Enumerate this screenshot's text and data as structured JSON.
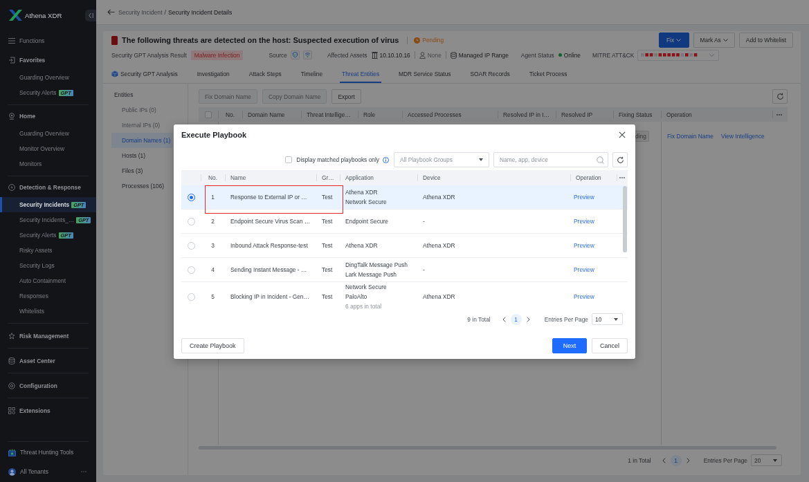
{
  "sidebar": {
    "brand": "Athena XDR",
    "functions_label": "Functions",
    "sections": [
      {
        "title": "Favorites",
        "items": [
          {
            "label": "Guarding Overview",
            "selected": false
          },
          {
            "label": "Security Alerts",
            "badge": "GPT",
            "selected": false
          }
        ]
      },
      {
        "title": "Home",
        "items": [
          {
            "label": "Guarding Overview",
            "selected": false
          },
          {
            "label": "Monitor Overview",
            "selected": false
          },
          {
            "label": "Monitors",
            "selected": false
          }
        ]
      },
      {
        "title": "Detection & Response",
        "items": [
          {
            "label": "Security Incidents",
            "badge": "GPT",
            "selected": true
          },
          {
            "label": "Security Incidents_…",
            "badge": "GPT",
            "selected": false
          },
          {
            "label": "Security Alerts",
            "badge": "GPT",
            "selected": false
          },
          {
            "label": "Risky Assets",
            "selected": false
          },
          {
            "label": "Security Logs",
            "selected": false
          },
          {
            "label": "Auto Containment",
            "selected": false
          },
          {
            "label": "Responses",
            "selected": false
          },
          {
            "label": "Whitelists",
            "selected": false
          }
        ]
      },
      {
        "title": "Risk Management"
      },
      {
        "title": "Asset Center"
      },
      {
        "title": "Configuration"
      },
      {
        "title": "Extensions"
      }
    ],
    "tools_link": "Threat Hunting Tools",
    "tenant": "All Tenants"
  },
  "breadcrumb": {
    "items": [
      "Security Incident",
      "Security Incident Details"
    ],
    "separator": "/"
  },
  "incident": {
    "title": "The following threats are detected on the host: Suspected execution of virus",
    "status": "Pending",
    "actions": [
      {
        "label": "Fix",
        "kind": "primary",
        "dropdown": true
      },
      {
        "label": "Mark As",
        "kind": "default",
        "dropdown": true
      },
      {
        "label": "Add to Whitelist",
        "kind": "default",
        "dropdown": false
      }
    ],
    "analysis_label": "Security GPT Analysis Result",
    "analysis_result": "Malware Infection",
    "source_label": "Source",
    "assets_label": "Affected Assets",
    "asset_ip": "10.10.10.16",
    "asset_user": "None",
    "asset_scope": "Managed IP Range",
    "agent_status_label": "Agent Status",
    "agent_status": "Online",
    "mitre_label": "MITRE ATT&CK"
  },
  "tabs": [
    {
      "label": "Security GPT Analysis",
      "selected": false
    },
    {
      "label": "Investigation",
      "selected": false
    },
    {
      "label": "Attack Steps",
      "selected": false
    },
    {
      "label": "Timeline",
      "selected": false
    },
    {
      "label": "Threat Entities",
      "selected": true
    },
    {
      "label": "MDR Service Status",
      "selected": false
    },
    {
      "label": "SOAR Records",
      "selected": false
    },
    {
      "label": "Ticket Process",
      "selected": false
    }
  ],
  "entities": {
    "title": "Entities",
    "items": [
      {
        "label": "Public IPs (0)",
        "disabled": true,
        "selected": false
      },
      {
        "label": "Internal IPs (0)",
        "disabled": true,
        "selected": false
      },
      {
        "label": "Domain Names (1)",
        "disabled": false,
        "selected": true
      },
      {
        "label": "Hosts (1)",
        "disabled": false,
        "selected": false
      },
      {
        "label": "Files (3)",
        "disabled": false,
        "selected": false
      },
      {
        "label": "Processes (106)",
        "disabled": false,
        "selected": false
      }
    ]
  },
  "entity_table": {
    "actions": [
      {
        "label": "Fix Domain Name",
        "disabled": true
      },
      {
        "label": "Copy Domain Name",
        "disabled": true
      },
      {
        "label": "Export",
        "disabled": false
      }
    ],
    "select_all": {
      "checked": false
    },
    "columns": [
      "No.",
      "Domain Name",
      "Threat Intellige…",
      "Role",
      "Accessed Processes",
      "Resolved IP in I…",
      "Resolved IP",
      "Fixing Status",
      "Operation"
    ],
    "rows": [
      {
        "fixing_status": "ding",
        "operations": [
          "Fix Domain Name",
          "View Intelligence"
        ]
      }
    ],
    "pagination": {
      "total": "1 in Total",
      "pages": [
        {
          "label": "1",
          "selected": true
        }
      ],
      "page_size_label": "Entries Per Page",
      "page_size": "20"
    }
  },
  "dialog": {
    "title": "Execute Playbook",
    "filter": {
      "matched_only": {
        "label": "Display matched playbooks only",
        "checked": false
      },
      "group_select": {
        "placeholder": "All Playbook Groups"
      },
      "search": {
        "placeholder": "Name, app, device"
      }
    },
    "columns": [
      "No.",
      "Name",
      "Gr…",
      "Application",
      "Device",
      "Operation"
    ],
    "rows": [
      {
        "no": "1",
        "name": "Response to External IP or …",
        "group": "Test",
        "applications": [
          "Athena XDR",
          "Network Secure"
        ],
        "device": "Athena XDR",
        "operation": "Preview",
        "selected": true,
        "highlighted": true
      },
      {
        "no": "2",
        "name": "Endpoint Secure Virus Scan …",
        "group": "Test",
        "applications": [
          "Endpoint Secure"
        ],
        "device": "-",
        "operation": "Preview",
        "selected": false,
        "highlighted": false
      },
      {
        "no": "3",
        "name": "Inbound Attack Response-test",
        "group": "Test",
        "applications": [
          "Athena XDR"
        ],
        "device": "Athena XDR",
        "operation": "Preview",
        "selected": false,
        "highlighted": false
      },
      {
        "no": "4",
        "name": "Sending Instant Message - …",
        "group": "Test",
        "applications": [
          "DingTalk Message Push",
          "Lark Message Push"
        ],
        "device": "-",
        "operation": "Preview",
        "selected": false,
        "highlighted": false
      },
      {
        "no": "5",
        "name": "Blocking IP in Incident - Gen…",
        "group": "Test",
        "applications": [
          "Network Secure",
          "PaloAlto"
        ],
        "apps_total": "6 apps in total",
        "device": "Athena XDR",
        "operation": "Preview",
        "selected": false,
        "highlighted": false
      }
    ],
    "pagination": {
      "total": "9 in Total",
      "pages": [
        {
          "label": "1",
          "selected": true
        }
      ],
      "page_size_label": "Entries Per Page",
      "page_size": "10"
    },
    "create_button": "Create Playbook",
    "buttons": [
      {
        "label": "Next",
        "kind": "primary"
      },
      {
        "label": "Cancel",
        "kind": "default"
      }
    ]
  }
}
